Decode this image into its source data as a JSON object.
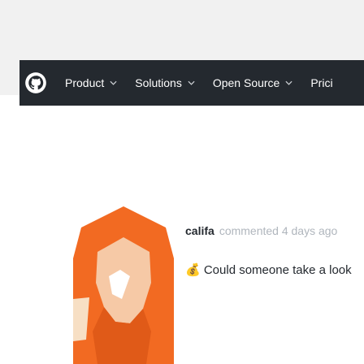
{
  "navbar": {
    "logo_icon": "github-logo-icon",
    "items": [
      {
        "label": "Product",
        "has_dropdown": true
      },
      {
        "label": "Solutions",
        "has_dropdown": true
      },
      {
        "label": "Open Source",
        "has_dropdown": true
      },
      {
        "label": "Prici",
        "has_dropdown": false
      }
    ],
    "background": "#24292f"
  },
  "comment": {
    "author": "califa",
    "meta": "commented 4 days ago",
    "body_icon": "money-bag-emoji",
    "body": "💰 Could someone take a look"
  },
  "colors": {
    "header_bg": "#f1f1f1",
    "avatar_orange": "#f26a22"
  }
}
